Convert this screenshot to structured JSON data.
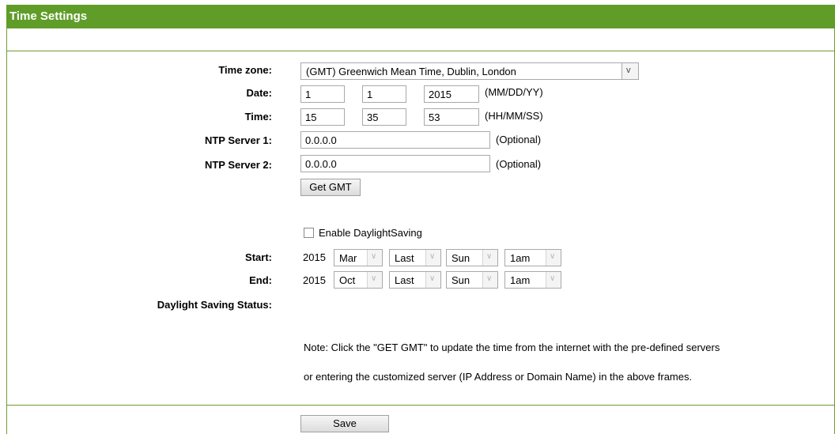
{
  "header": {
    "title": "Time Settings"
  },
  "timezone": {
    "label": "Time zone:",
    "value": "(GMT) Greenwich Mean Time, Dublin, London",
    "arrow": "v"
  },
  "date": {
    "label": "Date:",
    "month": "1",
    "day": "1",
    "year": "2015",
    "hint": "(MM/DD/YY)"
  },
  "time": {
    "label": "Time:",
    "hour": "15",
    "minute": "35",
    "second": "53",
    "hint": "(HH/MM/SS)"
  },
  "ntp1": {
    "label": "NTP Server 1:",
    "value": "0.0.0.0",
    "hint": "(Optional)"
  },
  "ntp2": {
    "label": "NTP Server 2:",
    "value": "0.0.0.0",
    "hint": "(Optional)"
  },
  "get_gmt_label": "Get GMT",
  "daylight": {
    "checkbox_label": "Enable DaylightSaving",
    "checked": false
  },
  "start": {
    "label": "Start:",
    "year": "2015",
    "month": "Mar",
    "week": "Last",
    "day": "Sun",
    "hour": "1am"
  },
  "end": {
    "label": "End:",
    "year": "2015",
    "month": "Oct",
    "week": "Last",
    "day": "Sun",
    "hour": "1am"
  },
  "status_label": "Daylight Saving Status:",
  "note_line1": "Note: Click the \"GET GMT\" to update the time from the internet with the pre-defined servers",
  "note_line2": "or entering the customized server (IP Address or Domain Name) in the above frames.",
  "save_label": "Save",
  "colors": {
    "header_bg": "#5f9d28",
    "border": "#6f9d2f"
  }
}
